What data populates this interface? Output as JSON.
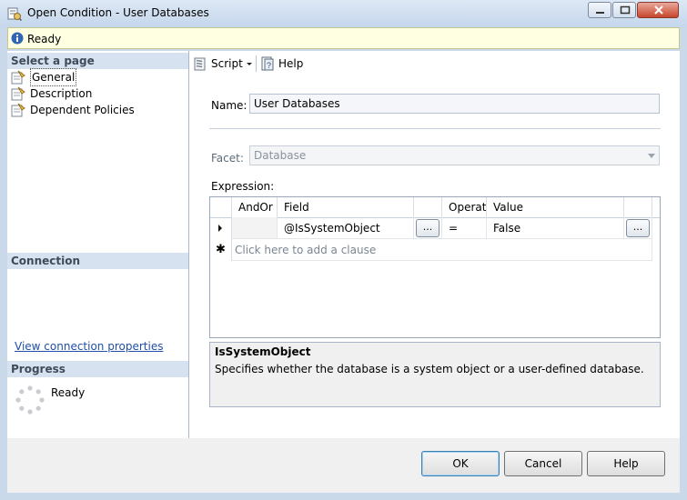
{
  "window": {
    "title": "Open Condition - User Databases",
    "icons": {
      "app": "condition-icon",
      "minimize": "minimize-icon",
      "maximize": "maximize-icon",
      "close": "close-icon"
    }
  },
  "status_bar": {
    "icon": "info-icon",
    "text": "Ready"
  },
  "left_pane": {
    "select_page_header": "Select a page",
    "pages": [
      {
        "label": "General",
        "icon": "page-icon",
        "selected": true
      },
      {
        "label": "Description",
        "icon": "page-icon",
        "selected": false
      },
      {
        "label": "Dependent Policies",
        "icon": "page-icon",
        "selected": false
      }
    ],
    "connection_header": "Connection",
    "connection_link": "View connection properties",
    "progress_header": "Progress",
    "progress_status": "Ready"
  },
  "toolbar": {
    "script_label": "Script",
    "help_label": "Help"
  },
  "form": {
    "name_label": "Name:",
    "name_value": "User Databases",
    "facet_label": "Facet:",
    "facet_value": "Database",
    "expression_label": "Expression:"
  },
  "grid": {
    "columns": [
      "AndOr",
      "Field",
      "",
      "Operatc",
      "Value",
      ""
    ],
    "rows": [
      {
        "indicator": "▸",
        "andor": "",
        "field": "@IsSystemObject",
        "field_button": "...",
        "operator": "=",
        "value": "False",
        "value_button": "..."
      }
    ],
    "new_row_indicator": "✱",
    "new_row_placeholder": "Click here to add a clause"
  },
  "description": {
    "title": "IsSystemObject",
    "text": "Specifies whether the database is a system object or a user-defined database."
  },
  "buttons": {
    "ok": "OK",
    "cancel": "Cancel",
    "help": "Help"
  },
  "colors": {
    "title_bar": "#c5d7ec",
    "status_bar": "#ffffe1",
    "section_header": "#d6e2f0",
    "link": "#1f4fa8",
    "close_button": "#c8452c"
  }
}
